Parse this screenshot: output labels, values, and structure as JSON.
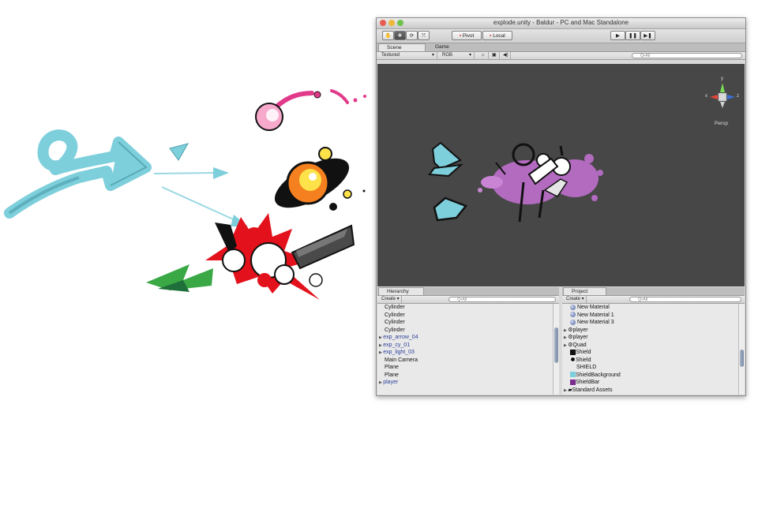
{
  "window": {
    "title": "explode.unity - Baldur - PC and Mac Standalone"
  },
  "toolbar": {
    "pivot_label": "Pivot",
    "local_label": "Local"
  },
  "scene_view": {
    "tabs": [
      "Scene",
      "Game"
    ],
    "render_mode": "Textured",
    "color_mode": "RGB",
    "search_placeholder": "Q•All",
    "gizmo_label": "Persp",
    "gizmo_axes": {
      "y": "y",
      "x": "x",
      "z": "z"
    }
  },
  "hierarchy": {
    "tab_label": "Hierarchy",
    "create_label": "Create ▾",
    "search_placeholder": "Q•All",
    "items": [
      {
        "label": "Cylinder",
        "expandable": false
      },
      {
        "label": "Cylinder",
        "expandable": false
      },
      {
        "label": "Cylinder",
        "expandable": false
      },
      {
        "label": "Cylinder",
        "expandable": false
      },
      {
        "label": "exp_arrow_04",
        "expandable": true
      },
      {
        "label": "exp_cy_01",
        "expandable": true
      },
      {
        "label": "exp_light_03",
        "expandable": true
      },
      {
        "label": "Main Camera",
        "expandable": false
      },
      {
        "label": "Plane",
        "expandable": false
      },
      {
        "label": "Plane",
        "expandable": false
      },
      {
        "label": "player",
        "expandable": true
      }
    ]
  },
  "project": {
    "tab_label": "Project",
    "create_label": "Create ▾",
    "search_placeholder": "Q•All",
    "items": [
      {
        "label": "New Material",
        "icon": "material-sphere-icon"
      },
      {
        "label": "New Material 1",
        "icon": "material-sphere-icon"
      },
      {
        "label": "New Material 3",
        "icon": "material-sphere-icon"
      },
      {
        "label": "player",
        "icon": "prefab-icon",
        "expandable": true
      },
      {
        "label": "player",
        "icon": "prefab-icon",
        "expandable": true
      },
      {
        "label": "Quad",
        "icon": "prefab-icon",
        "expandable": true
      },
      {
        "label": "Shield",
        "icon": "texture-icon"
      },
      {
        "label": "Shield",
        "icon": "shield-texture-icon"
      },
      {
        "label": "SHIELD",
        "icon": "none"
      },
      {
        "label": "ShieldBackground",
        "icon": "light-blue-texture-icon"
      },
      {
        "label": "ShieldBar",
        "icon": "purple-texture-icon"
      },
      {
        "label": "Standard Assets",
        "icon": "folder-icon",
        "expandable": true
      }
    ]
  },
  "colors": {
    "scene_bg": "#474747",
    "teal_arrow": "#7ecfdc",
    "pink_splat": "#b36bc0",
    "explosion_red": "#e3111b",
    "orange_core": "#f4801f",
    "comet_pink": "#e23a8a",
    "green_shape": "#3aa845"
  }
}
